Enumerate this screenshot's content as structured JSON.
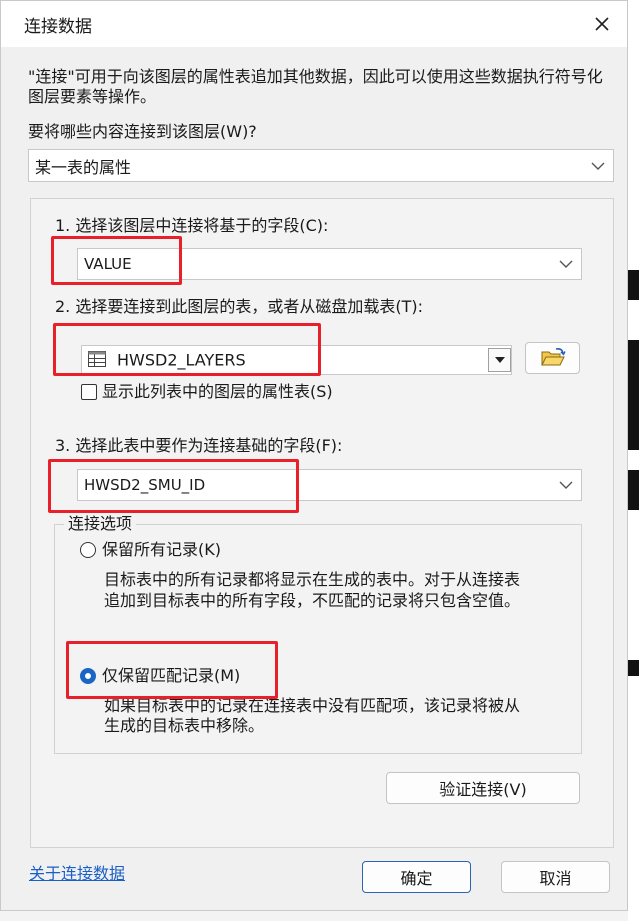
{
  "window": {
    "title": "连接数据"
  },
  "description": "\"连接\"可用于向该图层的属性表追加其他数据，因此可以使用这些数据执行符号化图层要素等操作。",
  "what_to_join": {
    "label": "要将哪些内容连接到该图层(W)?",
    "value": "某一表的属性"
  },
  "step1": {
    "label": "1. 选择该图层中连接将基于的字段(C):",
    "value": "VALUE"
  },
  "step2": {
    "label": "2. 选择要连接到此图层的表，或者从磁盘加载表(T):",
    "value": "HWSD2_LAYERS",
    "checkbox_label": "显示此列表中的图层的属性表(S)"
  },
  "step3": {
    "label": "3. 选择此表中要作为连接基础的字段(F):",
    "value": "HWSD2_SMU_ID"
  },
  "join_options": {
    "legend": "连接选项",
    "keep_all": {
      "label": "保留所有记录(K)",
      "desc_line1": "目标表中的所有记录都将显示在生成的表中。对于从连接表",
      "desc_line2": "追加到目标表中的所有字段，不匹配的记录将只包含空值。"
    },
    "keep_matching": {
      "label": "仅保留匹配记录(M)",
      "desc_line1": "如果目标表中的记录在连接表中没有匹配项，该记录将被从",
      "desc_line2": "生成的目标表中移除。"
    }
  },
  "buttons": {
    "validate": "验证连接(V)",
    "ok": "确定",
    "cancel": "取消"
  },
  "help_link": "关于连接数据",
  "colors": {
    "highlight": "#e8202a",
    "accent": "#1a66c4",
    "link": "#1a5fc8"
  }
}
